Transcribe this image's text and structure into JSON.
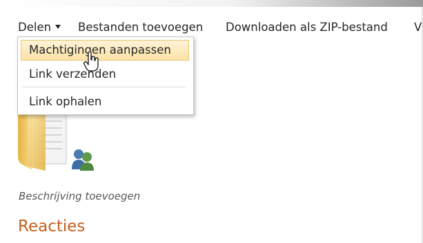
{
  "command_bar": {
    "share_label": "Delen",
    "add_files_label": "Bestanden toevoegen",
    "download_zip_label": "Downloaden als ZIP-bestand",
    "more_label": "V"
  },
  "share_menu": {
    "items": [
      {
        "label": "Machtigingen aanpassen",
        "state": "hover"
      },
      {
        "label": "Link verzenden"
      },
      {
        "label": "Link ophalen"
      }
    ]
  },
  "folder": {
    "icon": "shared-folder-icon",
    "description_placeholder": "Beschrijving toevoegen"
  },
  "comments": {
    "heading": "Reacties"
  },
  "colors": {
    "heading_accent": "#c5601c",
    "menu_highlight": "#fbe2a6",
    "menu_highlight_border": "#e8c570"
  }
}
